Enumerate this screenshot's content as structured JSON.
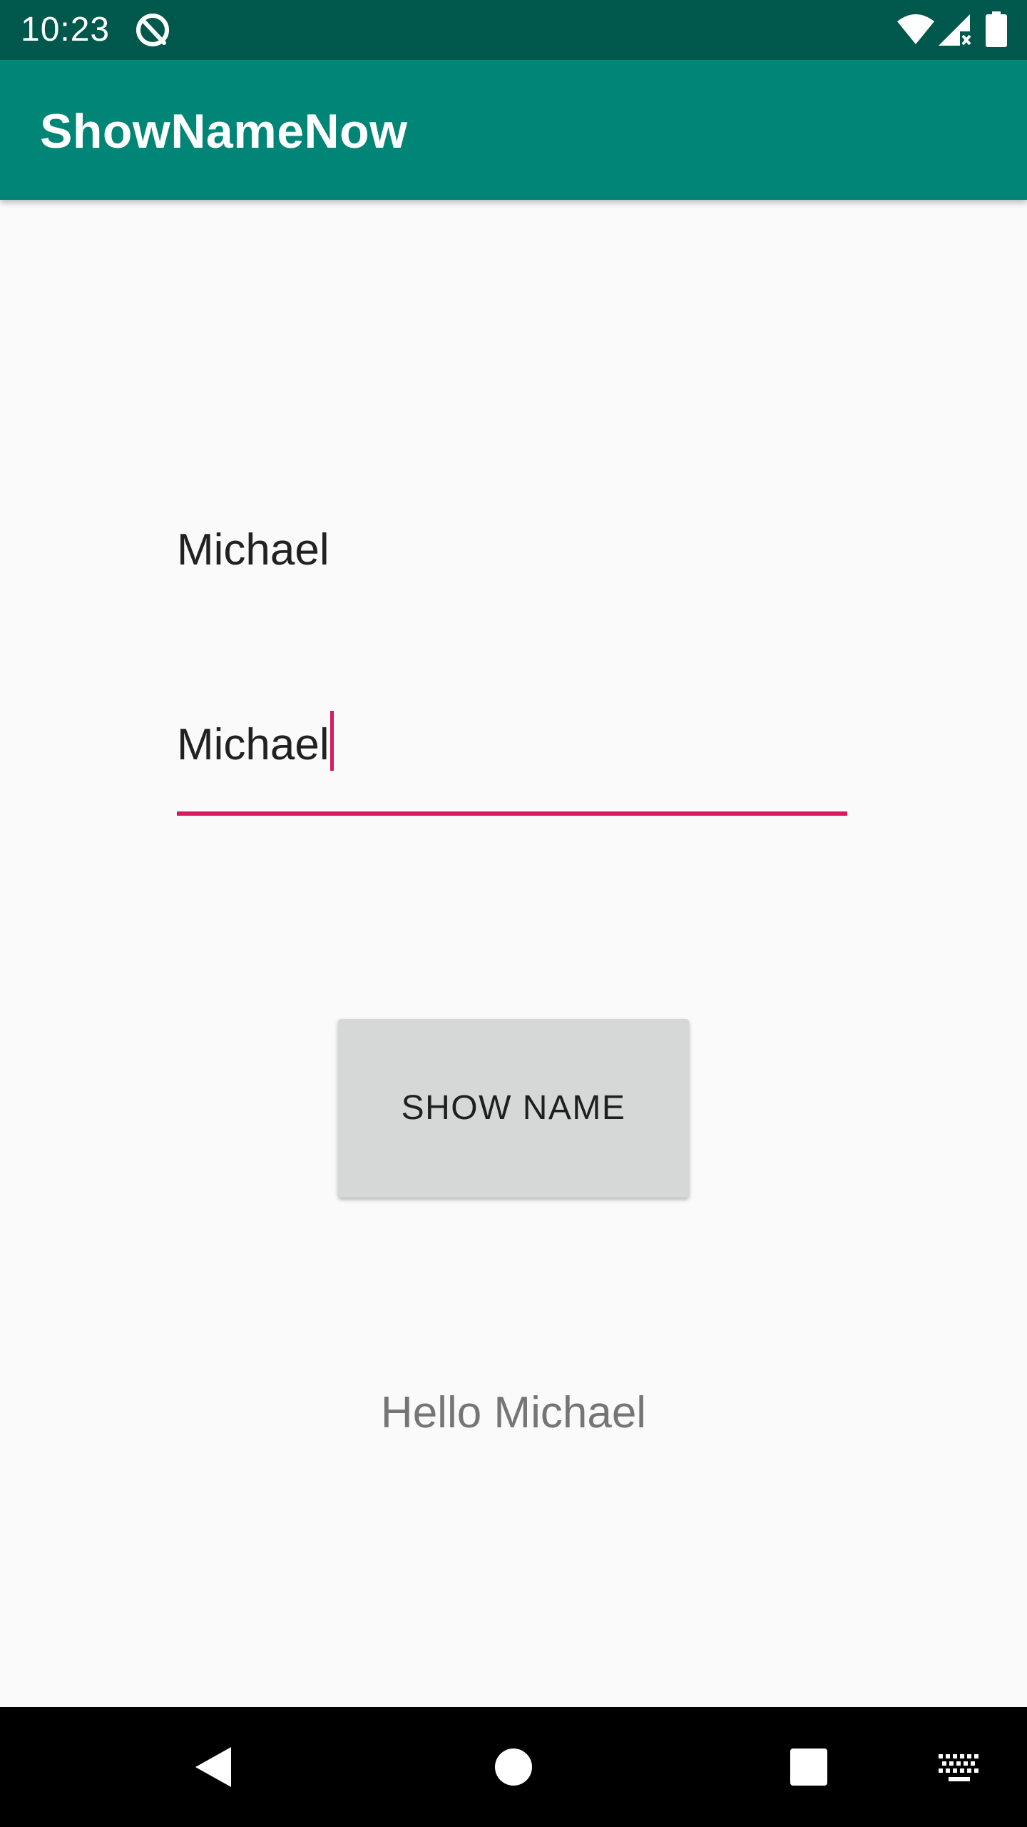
{
  "status_bar": {
    "time": "10:23",
    "icons": [
      "sync-disabled-icon",
      "wifi-icon",
      "cell-signal-no-data-icon",
      "battery-icon"
    ],
    "background_color": "#00574b"
  },
  "app_bar": {
    "title": "ShowNameNow",
    "background_color": "#008577"
  },
  "name_input": {
    "value": "Michael",
    "accent_color": "#d81b60"
  },
  "show_button": {
    "label": "SHOW NAME"
  },
  "greeting": {
    "text": "Hello Michael"
  },
  "nav_bar": {
    "items": [
      "back-icon",
      "home-icon",
      "recents-icon",
      "keyboard-icon"
    ]
  }
}
